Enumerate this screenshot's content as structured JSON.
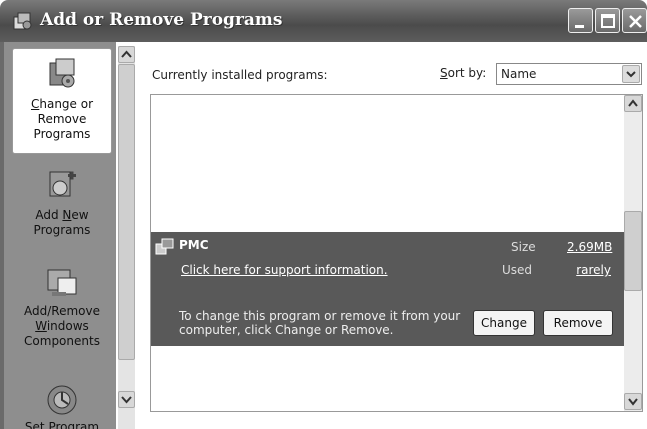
{
  "window": {
    "title": "Add or Remove Programs",
    "icon": "programs-window-icon"
  },
  "sidebar": {
    "items": [
      {
        "label_pre": "",
        "label_ul": "C",
        "label_rest": "hange or Remove Programs",
        "icon": "change-remove-icon",
        "selected": true
      },
      {
        "label_pre": "Add ",
        "label_ul": "N",
        "label_rest": "ew Programs",
        "icon": "add-new-icon",
        "selected": false
      },
      {
        "label_pre": "Add/Remove ",
        "label_ul": "W",
        "label_rest": "indows Components",
        "icon": "windows-components-icon",
        "selected": false
      },
      {
        "label_pre": "",
        "label_ul": "",
        "label_rest": "Set Program",
        "icon": "set-program-icon",
        "selected": false
      }
    ]
  },
  "main": {
    "installed_label": "Currently installed programs:",
    "sort_label": "Sort by:",
    "sort_value": "Name",
    "program": {
      "name": "PMC",
      "support_link": "Click here for support information.",
      "size_label": "Size",
      "size_value": "2.69MB",
      "used_label": "Used",
      "used_value": "rarely",
      "change_info": "To change this program or remove it from your computer, click Change or Remove.",
      "change_button": "Change",
      "remove_button": "Remove"
    }
  }
}
